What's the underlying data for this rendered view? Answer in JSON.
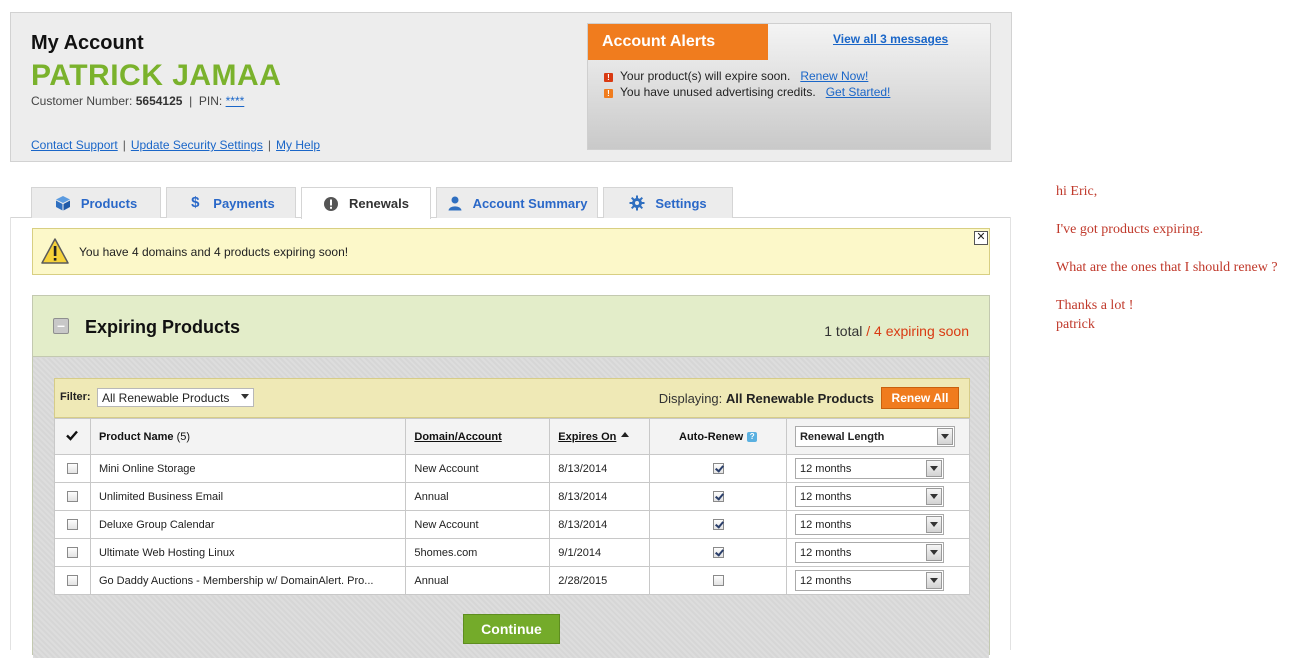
{
  "header": {
    "title": "My Account",
    "user_name": "PATRICK JAMAA",
    "customer_number_label": "Customer Number:",
    "customer_number": "5654125",
    "pin_label": "PIN:",
    "pin_value": "****",
    "links": [
      "Contact Support",
      "Update Security Settings",
      "My Help"
    ]
  },
  "alerts": {
    "title": "Account Alerts",
    "view_all": "View all 3 messages",
    "items": [
      {
        "text": "Your product(s) will expire soon.",
        "action": "Renew Now!",
        "color": "#d93a12"
      },
      {
        "text": "You have unused advertising credits.",
        "action": "Get Started!",
        "color": "#f07c1e"
      }
    ]
  },
  "tabs": [
    {
      "label": "Products",
      "icon": "box-icon"
    },
    {
      "label": "Payments",
      "icon": "dollar-icon"
    },
    {
      "label": "Renewals",
      "icon": "exclamation-icon"
    },
    {
      "label": "Account Summary",
      "icon": "person-icon"
    },
    {
      "label": "Settings",
      "icon": "gear-icon"
    }
  ],
  "warning": {
    "text": "You have 4 domains and 4 products expiring soon!",
    "close": "✕"
  },
  "expiring": {
    "title": "Expiring Products",
    "total": "1 total",
    "separator": " / ",
    "soon": "4 expiring soon",
    "filter_label": "Filter:",
    "filter_value": "All Renewable Products",
    "displaying_label": "Displaying:",
    "displaying_value": "All Renewable Products",
    "renew_all": "Renew All",
    "columns": {
      "product_name": "Product Name",
      "product_count": "(5)",
      "domain": "Domain/Account",
      "expires": "Expires On",
      "auto_renew": "Auto-Renew",
      "renewal_length": "Renewal Length"
    },
    "rows": [
      {
        "name": "Mini Online Storage",
        "domain": "New Account",
        "expires": "8/13/2014",
        "auto_renew": true,
        "length": "12 months"
      },
      {
        "name": "Unlimited Business Email",
        "domain": "Annual",
        "expires": "8/13/2014",
        "auto_renew": true,
        "length": "12 months"
      },
      {
        "name": "Deluxe Group Calendar",
        "domain": "New Account",
        "expires": "8/13/2014",
        "auto_renew": true,
        "length": "12 months"
      },
      {
        "name": "Ultimate Web Hosting Linux",
        "domain": "5homes.com",
        "expires": "9/1/2014",
        "auto_renew": true,
        "length": "12 months"
      },
      {
        "name": "Go Daddy Auctions - Membership w/ DomainAlert. Pro...",
        "domain": "Annual",
        "expires": "2/28/2015",
        "auto_renew": false,
        "length": "12 months"
      }
    ],
    "continue": "Continue"
  },
  "note": {
    "greeting": "hi Eric,",
    "line1": "I've got products expiring.",
    "line2": "What are the ones that I should renew ?",
    "thanks": "Thanks a lot !",
    "signature": "patrick"
  },
  "colors": {
    "brand_green": "#7ab22c",
    "alert_orange": "#f07c1e",
    "link_blue": "#1a66c8",
    "note_red": "#c0392b"
  }
}
